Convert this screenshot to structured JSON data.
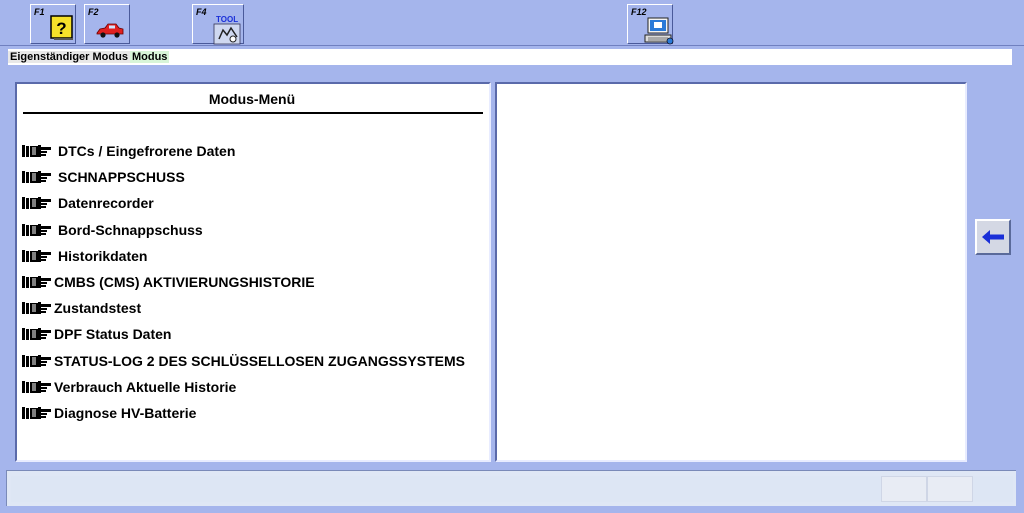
{
  "toolbar": {
    "keys": [
      {
        "label": "F1",
        "icon": "help-icon"
      },
      {
        "label": "F2",
        "icon": "car-icon"
      },
      {
        "label": "F4",
        "icon": "tool-icon",
        "icon_text": "TOOL"
      },
      {
        "label": "F12",
        "icon": "computer-icon"
      }
    ]
  },
  "breadcrumb": {
    "part1": "Eigenständiger Modus",
    "part2": "Modus"
  },
  "menu": {
    "title": "Modus-Menü",
    "items": [
      {
        "label": "DTCs / Eingefrorene Daten"
      },
      {
        "label": "SCHNAPPSCHUSS"
      },
      {
        "label": "Datenrecorder"
      },
      {
        "label": "Bord-Schnappschuss"
      },
      {
        "label": "Historikdaten"
      },
      {
        "label": "CMBS (CMS) AKTIVIERUNGSHISTORIE"
      },
      {
        "label": "Zustandstest"
      },
      {
        "label": "DPF Status Daten"
      },
      {
        "label": "STATUS-LOG 2 DES SCHLÜSSELLOSEN ZUGANGSSYSTEMS"
      },
      {
        "label": "Verbrauch Aktuelle Historie"
      },
      {
        "label": "Diagnose HV-Batterie"
      }
    ]
  },
  "colors": {
    "background": "#a5b5ec",
    "panel": "#ffffff",
    "arrow": "#1a2fd8"
  }
}
